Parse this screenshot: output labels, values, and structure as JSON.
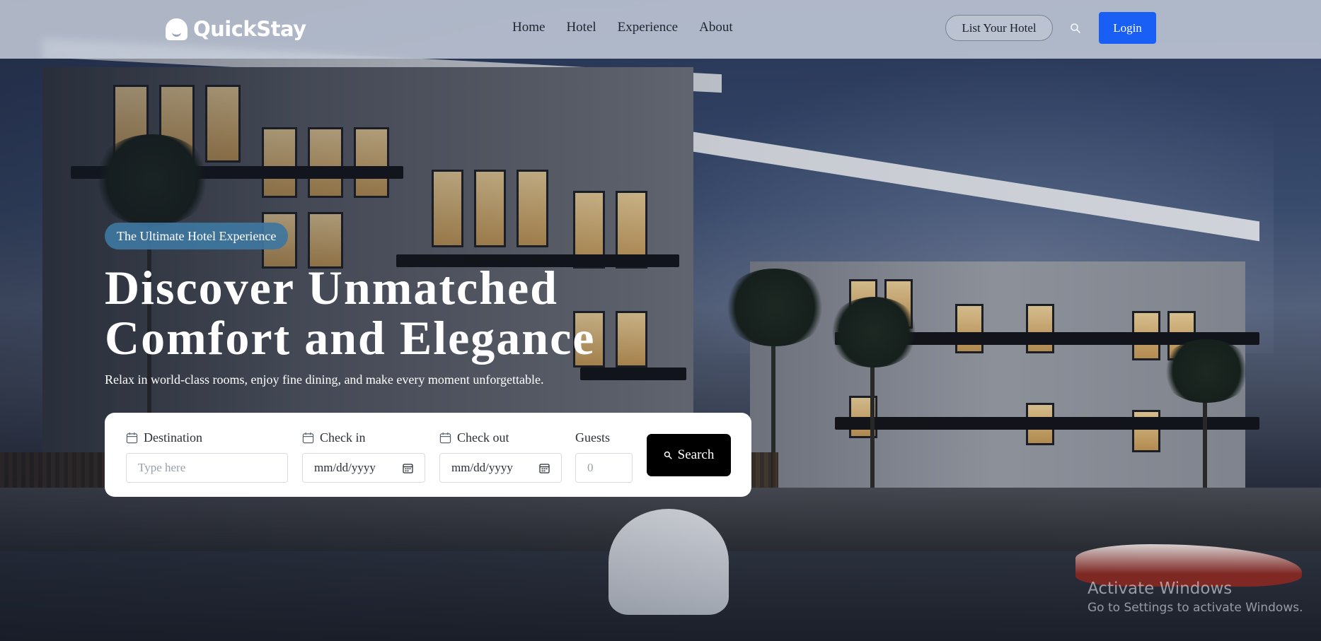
{
  "brand": {
    "name": "QuickStay"
  },
  "nav": {
    "links": [
      "Home",
      "Hotel",
      "Experience",
      "About"
    ],
    "list_hotel": "List Your Hotel",
    "login": "Login"
  },
  "hero": {
    "tagline": "The Ultimate Hotel Experience",
    "headline": "Discover Unmatched Comfort and Elegance",
    "subtext": "Relax in world-class rooms, enjoy fine dining, and make every moment unforgettable."
  },
  "search": {
    "destination_label": "Destination",
    "destination_placeholder": "Type here",
    "checkin_label": "Check in",
    "checkin_placeholder": "mm/dd/yyyy",
    "checkout_label": "Check out",
    "checkout_placeholder": "mm/dd/yyyy",
    "guests_label": "Guests",
    "guests_placeholder": "0",
    "button": "Search"
  },
  "watermark": {
    "title": "Activate Windows",
    "subtitle": "Go to Settings to activate Windows."
  },
  "colors": {
    "login_bg": "#1a5ff5",
    "tagline_bg": "#3e76a0",
    "search_btn_bg": "#000000"
  },
  "icons": [
    "logo-icon",
    "search-icon",
    "calendar-icon"
  ]
}
